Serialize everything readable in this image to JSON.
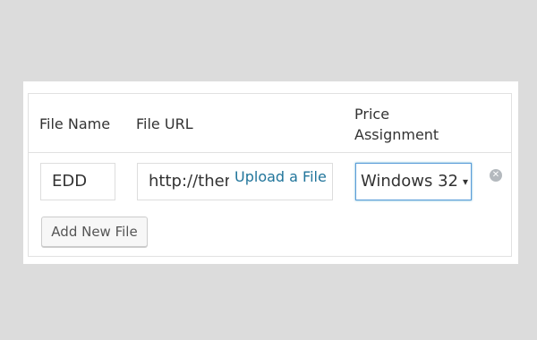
{
  "table": {
    "headers": {
      "file_name": "File Name",
      "file_url": "File URL",
      "price_assignment": "Price Assignment"
    },
    "rows": [
      {
        "file_name_value": "EDD",
        "file_url_value": "http://themeisle.com",
        "upload_link_label": "Upload a File",
        "price_assignment_value": "Windows 32",
        "remove_icon": "close-circle-icon"
      }
    ],
    "add_button_label": "Add New File"
  },
  "colors": {
    "link": "#21759b",
    "focus_border": "#5b9dd9",
    "page_background": "#dcdcdc"
  }
}
